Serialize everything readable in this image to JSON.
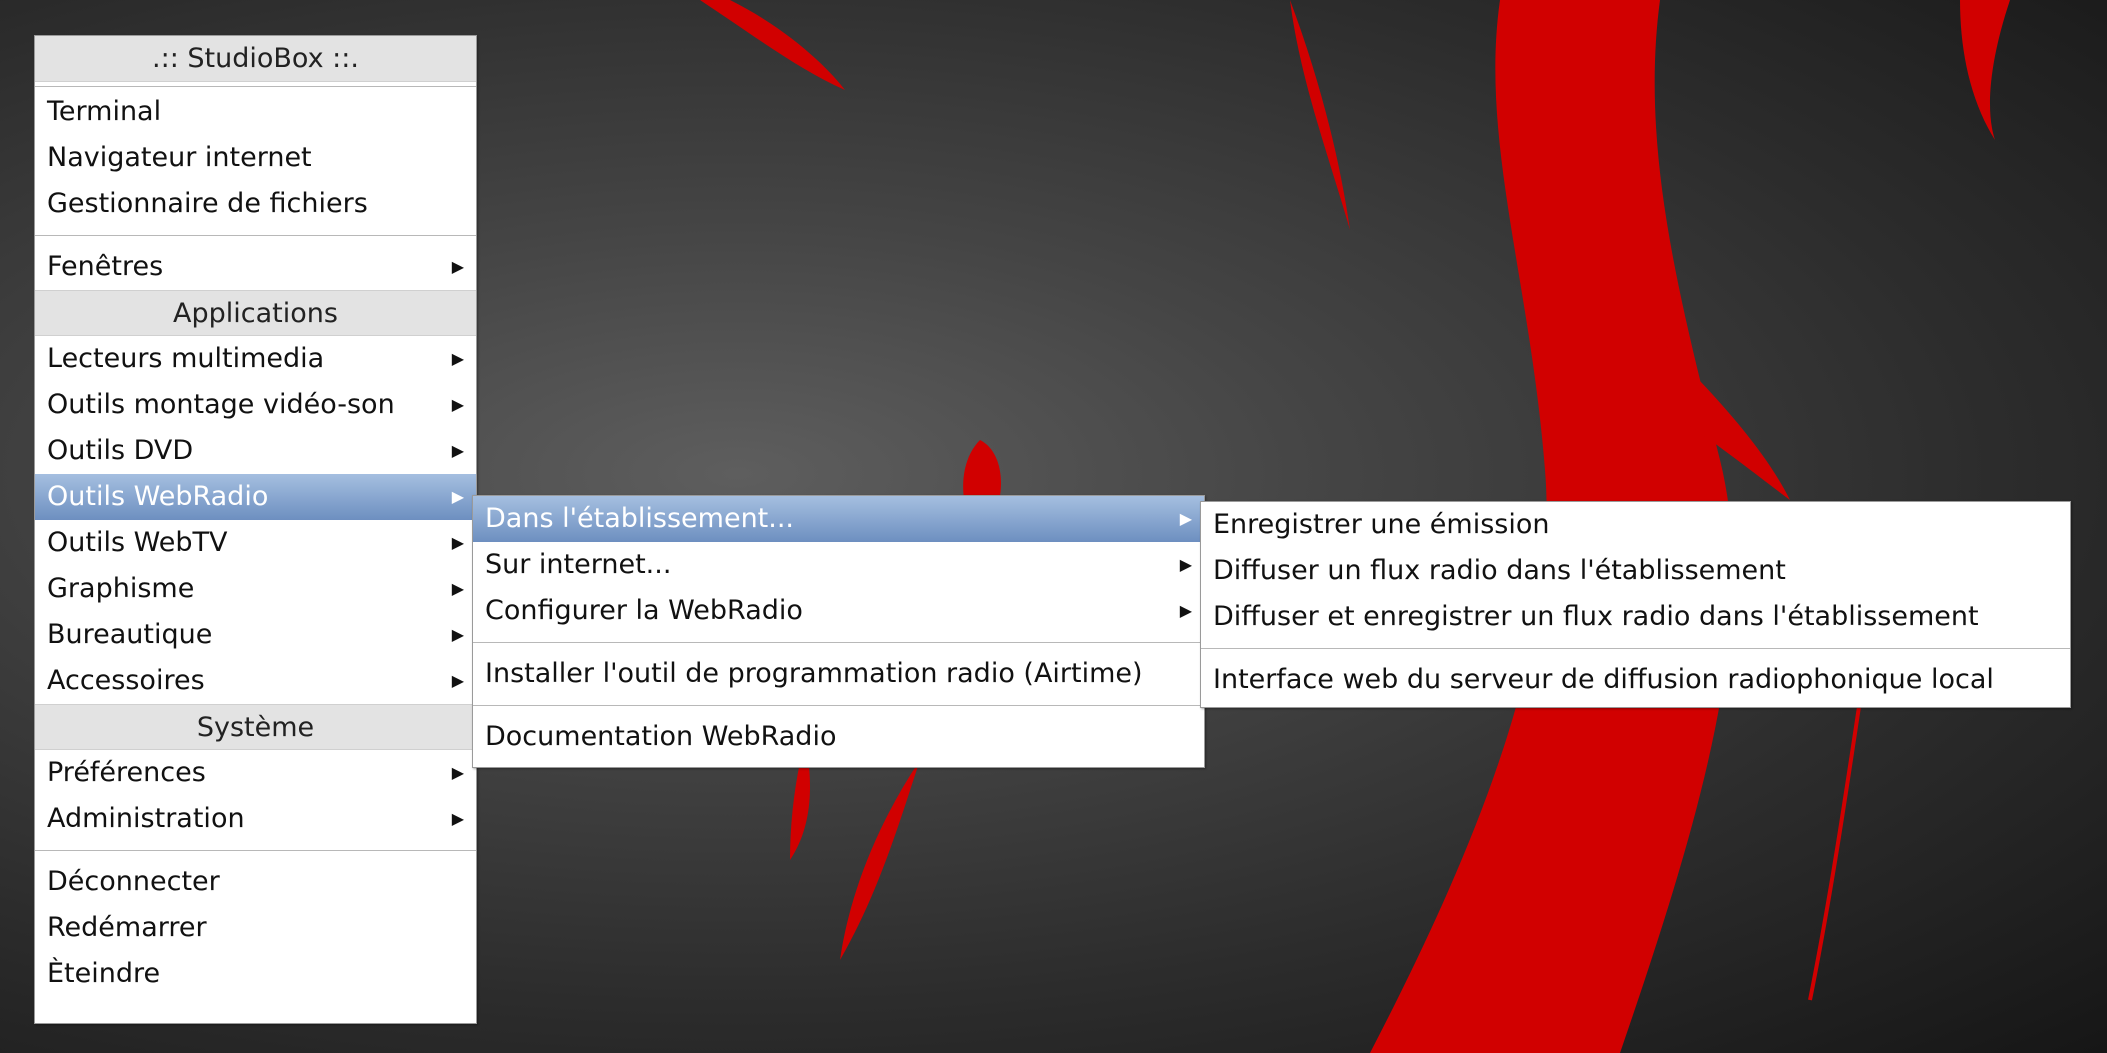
{
  "main_menu": {
    "title": ".:: StudioBox ::.",
    "top_items": [
      "Terminal",
      "Navigateur internet",
      "Gestionnaire de fichiers"
    ],
    "windows_item": "Fenêtres",
    "apps_header": "Applications",
    "apps": [
      {
        "label": "Lecteurs multimedia",
        "submenu": true
      },
      {
        "label": "Outils montage vidéo-son",
        "submenu": true
      },
      {
        "label": "Outils DVD",
        "submenu": true
      },
      {
        "label": "Outils WebRadio",
        "submenu": true,
        "active": true
      },
      {
        "label": "Outils WebTV",
        "submenu": true
      },
      {
        "label": "Graphisme",
        "submenu": true
      },
      {
        "label": "Bureautique",
        "submenu": true
      },
      {
        "label": "Accessoires",
        "submenu": true
      }
    ],
    "system_header": "Système",
    "system_items": [
      "Préférences",
      "Administration"
    ],
    "session_items": [
      "Déconnecter",
      "Redémarrer",
      "Èteindre"
    ]
  },
  "webradio_menu": {
    "items": [
      {
        "label": "Dans l'établissement...",
        "submenu": true,
        "active": true
      },
      {
        "label": "Sur internet...",
        "submenu": true
      },
      {
        "label": "Configurer la WebRadio",
        "submenu": true
      }
    ],
    "install_item": "Installer l'outil de programmation radio (Airtime)",
    "doc_item": "Documentation WebRadio"
  },
  "etablissement_menu": {
    "items": [
      "Enregistrer une émission",
      "Diffuser un flux radio dans l'établissement",
      "Diffuser et enregistrer un flux radio dans l'établissement"
    ],
    "interface_item": "Interface web du serveur de diffusion radiophonique local"
  },
  "icons": {
    "submenu_arrow": "▶"
  },
  "colors": {
    "accent_red": "#d10000",
    "highlight": "#7596c8",
    "header_bg": "#e3e3e3"
  }
}
